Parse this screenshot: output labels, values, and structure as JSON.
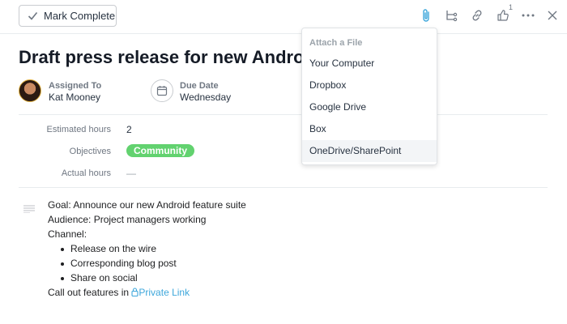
{
  "toolbar": {
    "mark_complete_label": "Mark Complete",
    "like_count": "1",
    "active_color": "#3ea7db"
  },
  "task": {
    "title": "Draft press release for new Android f",
    "assigned_to_label": "Assigned To",
    "assignee_name": "Kat Mooney",
    "due_date_label": "Due Date",
    "due_date_value": "Wednesday"
  },
  "custom_fields": {
    "estimated_hours_label": "Estimated hours",
    "estimated_hours_value": "2",
    "objectives_label": "Objectives",
    "objectives_value": "Community",
    "objectives_color": "#62d26f",
    "actual_hours_label": "Actual hours",
    "actual_hours_value": "—"
  },
  "description": {
    "goal": "Goal: Announce our new Android feature suite",
    "audience": "Audience: Project managers working",
    "channel": "Channel:",
    "bullets": [
      "Release on the wire",
      "Corresponding blog post",
      "Share on social"
    ],
    "call_out_prefix": "Call out features in ",
    "private_link": "Private Link"
  },
  "attach_menu": {
    "header": "Attach a File",
    "items": [
      {
        "label": "Your Computer"
      },
      {
        "label": "Dropbox"
      },
      {
        "label": "Google Drive"
      },
      {
        "label": "Box"
      },
      {
        "label": "OneDrive/SharePoint"
      }
    ]
  }
}
